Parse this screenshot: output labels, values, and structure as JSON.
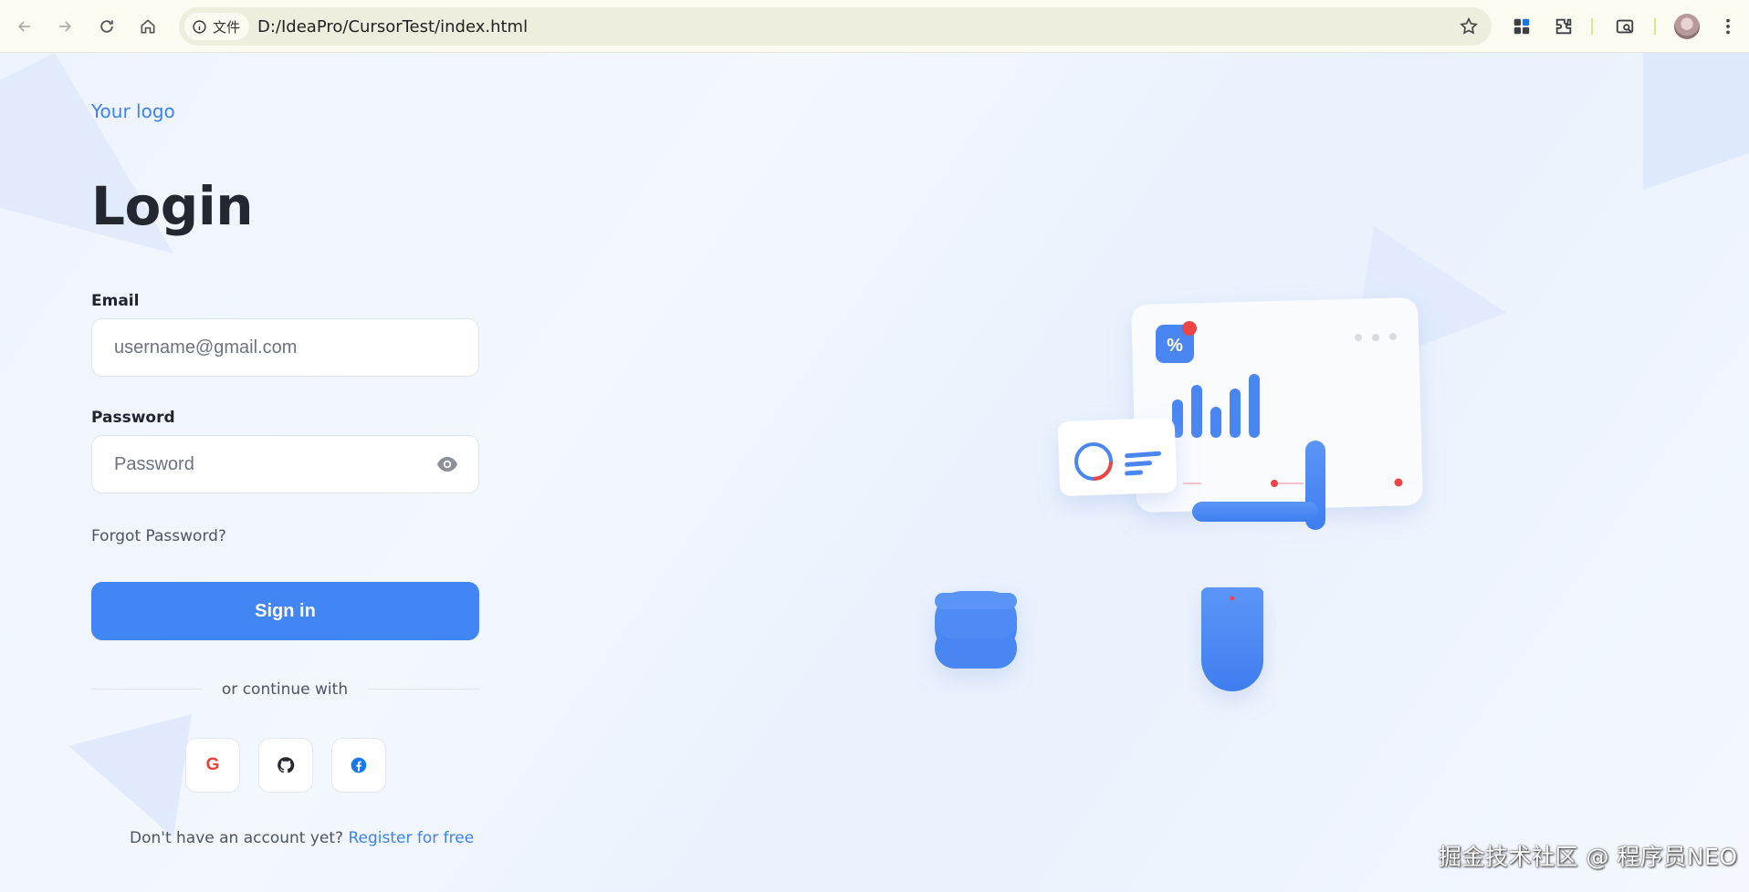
{
  "browser": {
    "site_chip_label": "文件",
    "url": "D:/IdeaPro/CursorTest/index.html"
  },
  "logo": "Your logo",
  "title": "Login",
  "email": {
    "label": "Email",
    "placeholder": "username@gmail.com"
  },
  "password": {
    "label": "Password",
    "placeholder": "Password"
  },
  "forgot_password": "Forgot Password?",
  "signin_label": "Sign in",
  "divider_text": "or continue with",
  "social": [
    {
      "name": "google",
      "icon": "google-icon",
      "glyph": "G",
      "color": "#ea4335"
    },
    {
      "name": "github",
      "icon": "github-icon",
      "color": "#24292f"
    },
    {
      "name": "facebook",
      "icon": "facebook-icon",
      "color": "#1877f2"
    }
  ],
  "register": {
    "prompt": "Don't have an account yet?",
    "link": "Register for free"
  },
  "illustration": {
    "badge_glyph": "%"
  },
  "watermark": "掘金技术社区 @ 程序员NEO",
  "colors": {
    "accent": "#4285f4",
    "link": "#3b82f6",
    "notification": "#ef4444"
  }
}
